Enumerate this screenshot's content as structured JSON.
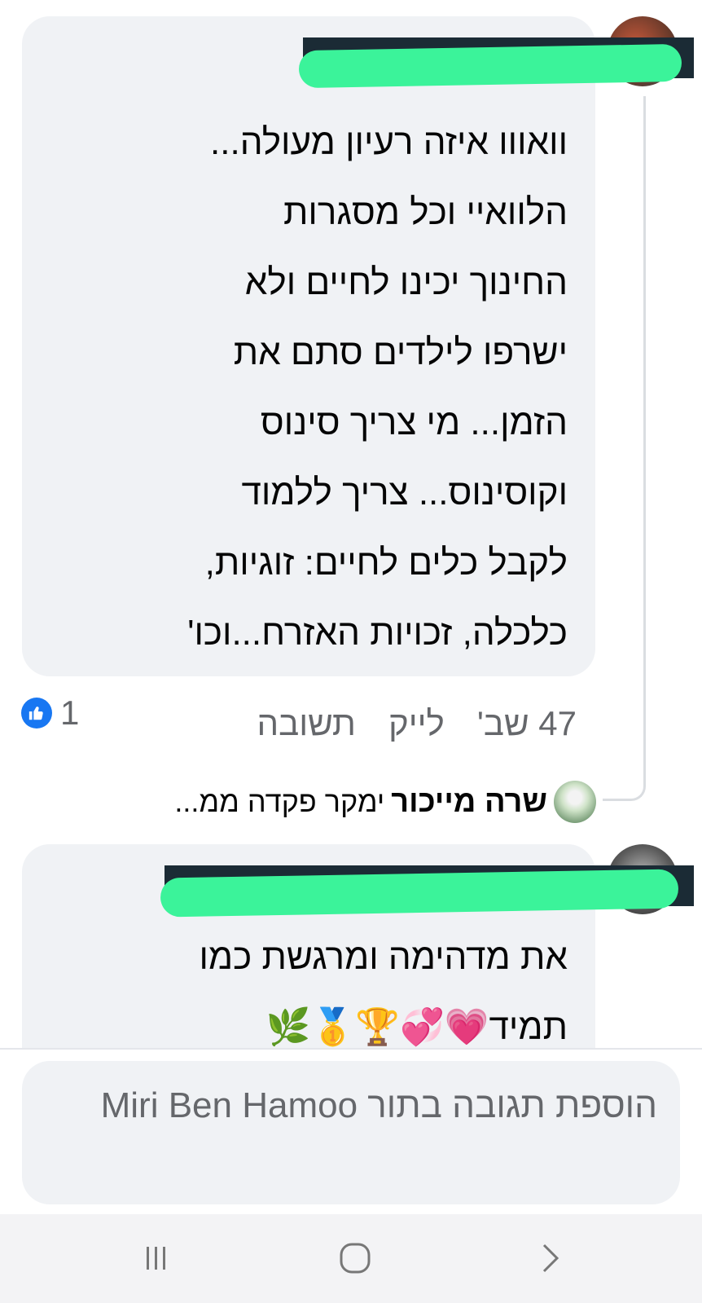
{
  "comments": [
    {
      "author_redacted": true,
      "text_lines": [
        "וואווו איזה רעיון מעולה...",
        "הלוואיי וכל מסגרות",
        "החינוך יכינו לחיים ולא",
        "ישרפו לילדים סתם את",
        "הזמן... מי צריך סינוס",
        "וקוסינוס... צריך ללמוד",
        "לקבל כלים לחיים: זוגיות,",
        "כלכלה, זכויות האזרח...וכו'"
      ],
      "time": "47 שב'",
      "like_label": "לייק",
      "reply_label": "תשובה",
      "reaction_count": "1",
      "reaction_icon": "like-icon"
    },
    {
      "author_redacted": true,
      "text_line_1": "את מדהימה ומרגשת כמו",
      "text_line_2": "תמיד💗💞🏆🥇🌿"
    }
  ],
  "reply_preview": {
    "name": "שרה מייכור",
    "snippet": " ימקר פקדה ממ..."
  },
  "composer": {
    "placeholder": "הוספת תגובה בתור Miri Ben Hamoo"
  },
  "navbar": {
    "recent_icon": "recent-apps-icon",
    "home_icon": "home-icon",
    "back_icon": "back-icon"
  },
  "colors": {
    "bubble": "#f0f2f5",
    "like_blue": "#1877f2",
    "muted_text": "#65676b",
    "redaction": "#3bf39a"
  }
}
